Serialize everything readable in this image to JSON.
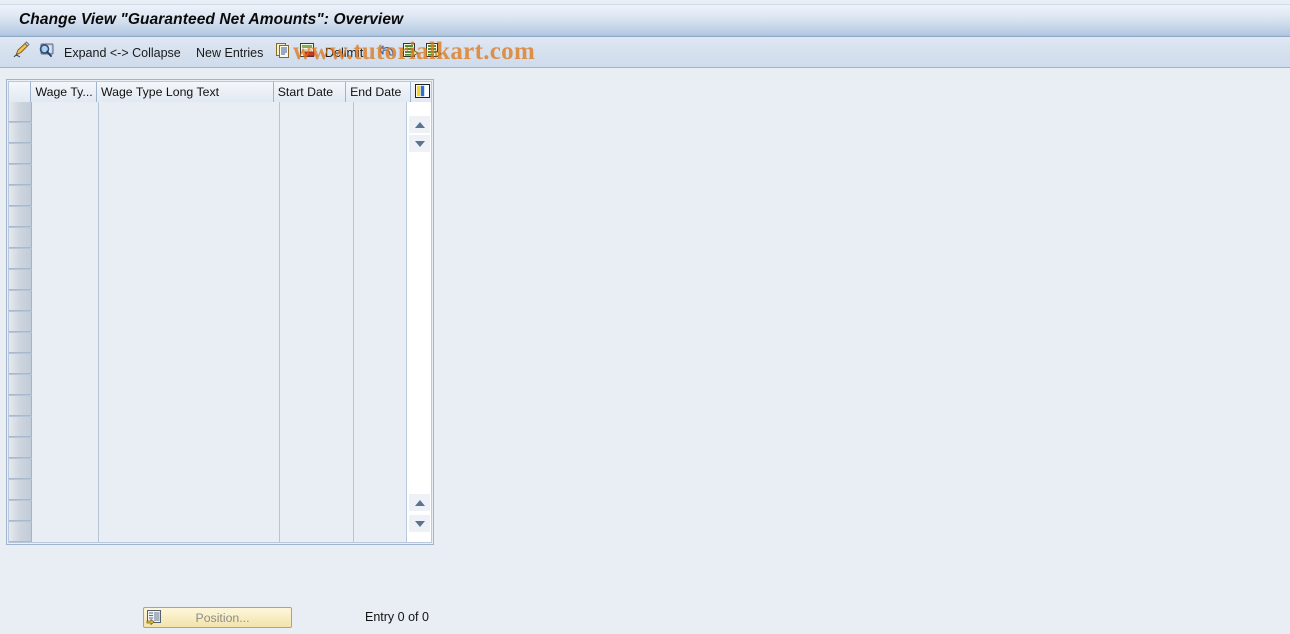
{
  "window": {
    "title": "Change View \"Guaranteed Net Amounts\": Overview"
  },
  "watermark": {
    "text": "www.tutorialkart.com",
    "color": "#de7819"
  },
  "toolbar": {
    "items": [
      {
        "name": "display-change-toggle",
        "icon": "pencil-edit-icon",
        "label": ""
      },
      {
        "name": "display-details",
        "icon": "magnifier-display-icon",
        "label": ""
      },
      {
        "name": "expand-collapse",
        "icon": "",
        "label": "Expand <-> Collapse"
      },
      {
        "name": "new-entries",
        "icon": "",
        "label": "New Entries"
      },
      {
        "name": "copy-as",
        "icon": "copy-documents-icon",
        "label": ""
      },
      {
        "name": "delete",
        "icon": "delete-row-icon",
        "label": ""
      },
      {
        "name": "delimit",
        "icon": "",
        "label": "Delimit"
      },
      {
        "name": "undo",
        "icon": "undo-arrow-icon",
        "label": ""
      },
      {
        "name": "previous-entry",
        "icon": "previous-entry-icon",
        "label": ""
      },
      {
        "name": "next-entry",
        "icon": "next-entry-icon",
        "label": ""
      }
    ]
  },
  "table": {
    "columns": [
      {
        "key": "wage_type",
        "label": "Wage Ty..."
      },
      {
        "key": "wage_type_long_text",
        "label": "Wage Type Long Text"
      },
      {
        "key": "start_date",
        "label": "Start Date"
      },
      {
        "key": "end_date",
        "label": "End Date"
      }
    ],
    "config_icon": "column-settings-icon",
    "rows": [],
    "empty_row_count": 21,
    "scroll": {
      "top_up": "scroll-up-icon",
      "top_down": "scroll-down-icon",
      "bottom_up": "scroll-page-up-icon",
      "bottom_down": "scroll-page-down-icon"
    }
  },
  "footer": {
    "position_button": {
      "label": "Position...",
      "icon": "position-icon",
      "enabled": false
    },
    "entry_status": "Entry 0 of 0"
  },
  "colors": {
    "background": "#e9eef5",
    "title_bar_start": "#eef3f9",
    "title_bar_end": "#a9c0dc",
    "toolbar": "#d5e0ee",
    "grid_line": "#b6c6d8",
    "button_yellow": "#f8edc2"
  }
}
